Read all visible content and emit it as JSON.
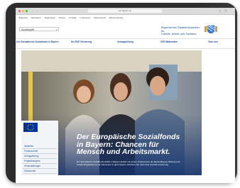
{
  "browser": {
    "url": "esf.bayern.de"
  },
  "topnav": [
    "Startseite",
    "Newsletter",
    "Ergebnisse",
    "Presse",
    "Kontakt",
    "Impressum",
    "Datenschutz",
    "Barrierefreiheit"
  ],
  "search": {
    "placeholder": "Suchbegriff"
  },
  "ministry": {
    "line1": "Bayerisches Staatsministerium für",
    "line2": "Familie, Arbeit und Soziales"
  },
  "mainnav": [
    "Der Europäische Sozialfonds in Bayern",
    "Der ESF-Förderung",
    "Antragstellung",
    "ESF-Materialien",
    "Über uns"
  ],
  "sidebar": {
    "items": [
      "Aktuelles",
      "Förderaufrufe",
      "Antragstellung",
      "Projektbeispiele",
      "Veranstaltungen",
      "Dokumente"
    ]
  },
  "hero": {
    "headline": "Der Europäische Sozialfonds in Bayern: Chancen für Mensch und Arbeitsmarkt.",
    "body": "Der Europäische Sozialfonds (ESF) in Bayern fördert mit seinen Programmen die Beschäftigung, Bildung und soziale Eingliederung von Menschen in ganz Bayern. Erfahren Sie mehr über die ESF-Förderung."
  },
  "colors": {
    "accent": "#1a4d8f",
    "eu_blue": "#003399",
    "device": "#2c2c2e"
  }
}
